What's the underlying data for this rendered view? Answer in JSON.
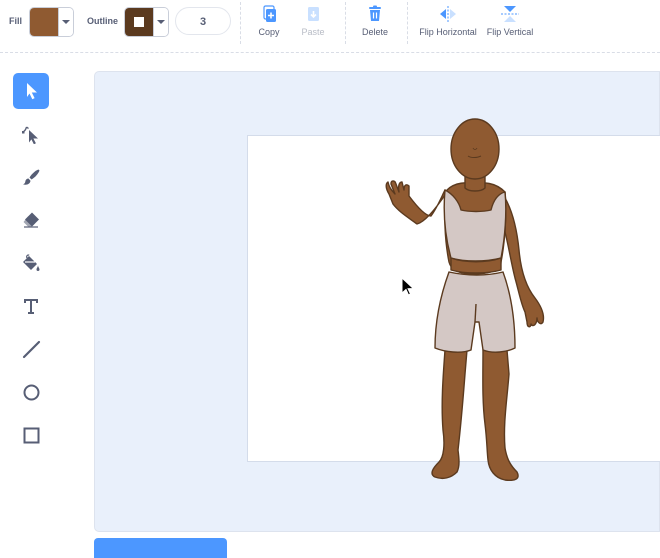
{
  "toolbar": {
    "fill_label": "Fill",
    "fill_color": "#8f5a31",
    "outline_label": "Outline",
    "outline_color": "#5b3a1f",
    "outline_width": "3",
    "copy_label": "Copy",
    "paste_label": "Paste",
    "delete_label": "Delete",
    "flip_horizontal_label": "Flip Horizontal",
    "flip_vertical_label": "Flip Vertical"
  },
  "tools": [
    {
      "name": "select-tool",
      "icon": "arrow-cursor-icon",
      "active": true
    },
    {
      "name": "reshape-tool",
      "icon": "reshape-icon",
      "active": false
    },
    {
      "name": "brush-tool",
      "icon": "brush-icon",
      "active": false
    },
    {
      "name": "eraser-tool",
      "icon": "eraser-icon",
      "active": false
    },
    {
      "name": "fill-tool",
      "icon": "paint-bucket-icon",
      "active": false
    },
    {
      "name": "text-tool",
      "icon": "text-icon",
      "active": false
    },
    {
      "name": "line-tool",
      "icon": "line-icon",
      "active": false
    },
    {
      "name": "circle-tool",
      "icon": "circle-icon",
      "active": false
    },
    {
      "name": "rectangle-tool",
      "icon": "rectangle-icon",
      "active": false
    }
  ],
  "colors": {
    "accent": "#4c97ff",
    "skin": "#8f5a31",
    "outline": "#5b3a1f",
    "clothing": "#d4c8c5",
    "canvas_background": "#e9f0fb"
  }
}
